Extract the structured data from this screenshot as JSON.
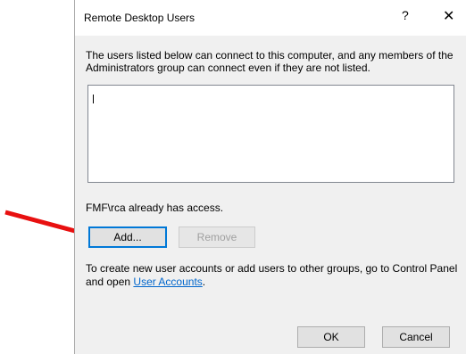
{
  "dialog": {
    "title": "Remote Desktop Users",
    "help_glyph": "?",
    "close_glyph": "✕",
    "description": "The users listed below can connect to this computer, and any members of the Administrators group can connect even if they are not listed.",
    "access_text": "FMF\\rca already has access.",
    "add_label": "Add...",
    "remove_label": "Remove",
    "info_text": "To create new user accounts or add users to other groups, go to Control Panel and open",
    "link_label": "User Accounts",
    "info_suffix": ".",
    "ok_label": "OK",
    "cancel_label": "Cancel"
  },
  "colors": {
    "arrow": "#e81010",
    "link": "#0066cc",
    "focus": "#0078d7"
  }
}
